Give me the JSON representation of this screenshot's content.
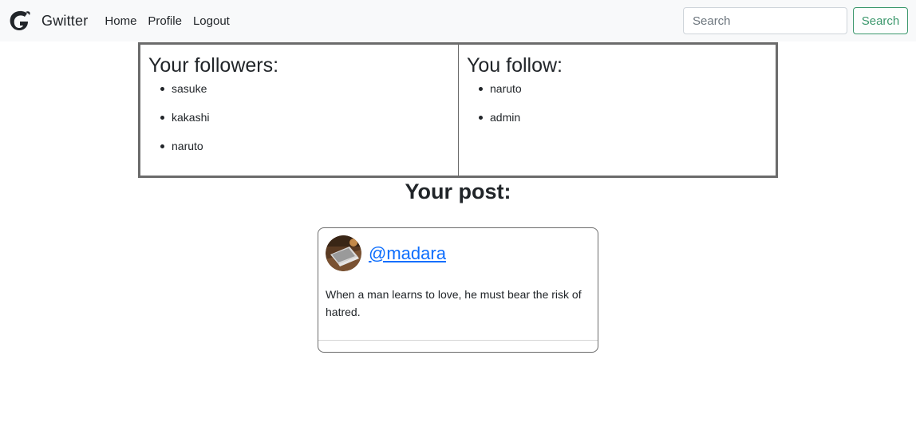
{
  "navbar": {
    "brand_name": "Gwitter",
    "links": [
      "Home",
      "Profile",
      "Logout"
    ],
    "search_placeholder": "Search",
    "search_button_label": "Search"
  },
  "followers": {
    "title": "Your followers:",
    "items": [
      "sasuke",
      "kakashi",
      "naruto"
    ]
  },
  "following": {
    "title": "You follow:",
    "items": [
      "naruto",
      "admin"
    ]
  },
  "posts_section": {
    "heading": "Your post:"
  },
  "post": {
    "username": "@madara",
    "text": "When a man learns to love, he must bear the risk of hatred."
  }
}
